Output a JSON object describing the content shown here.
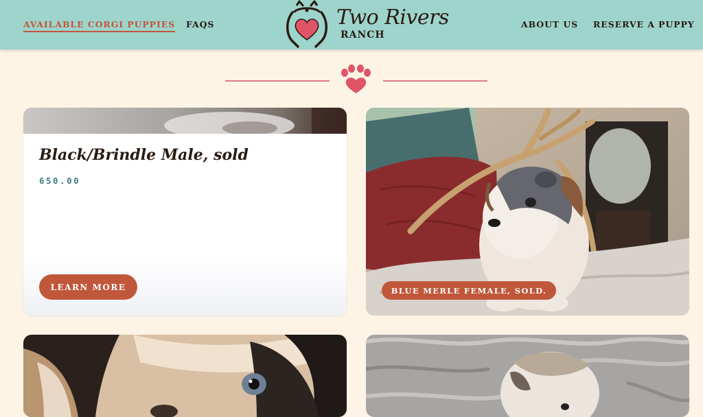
{
  "nav": {
    "left": [
      {
        "label": "AVAILABLE CORGI PUPPIES",
        "active": true
      },
      {
        "label": "FAQS",
        "active": false
      }
    ],
    "right": [
      {
        "label": "ABOUT US"
      },
      {
        "label": "RESERVE A PUPPY"
      }
    ]
  },
  "logo": {
    "title": "Two Rivers",
    "subtitle": "RANCH"
  },
  "colors": {
    "header_bg": "#9dd4cc",
    "page_bg": "#fdf4e6",
    "accent": "#c0573a",
    "paw": "#e05468",
    "price_text": "#3e7c86",
    "dark_text": "#2a1a10"
  },
  "listings": [
    {
      "title": "Black/Brindle Male, sold",
      "price": "650.00",
      "button_label": "LEARN MORE"
    },
    {
      "badge": "BLUE MERLE FEMALE, SOLD."
    }
  ],
  "icons": {
    "divider": "paw-print-icon",
    "logo": "heart-corgi-icon"
  }
}
